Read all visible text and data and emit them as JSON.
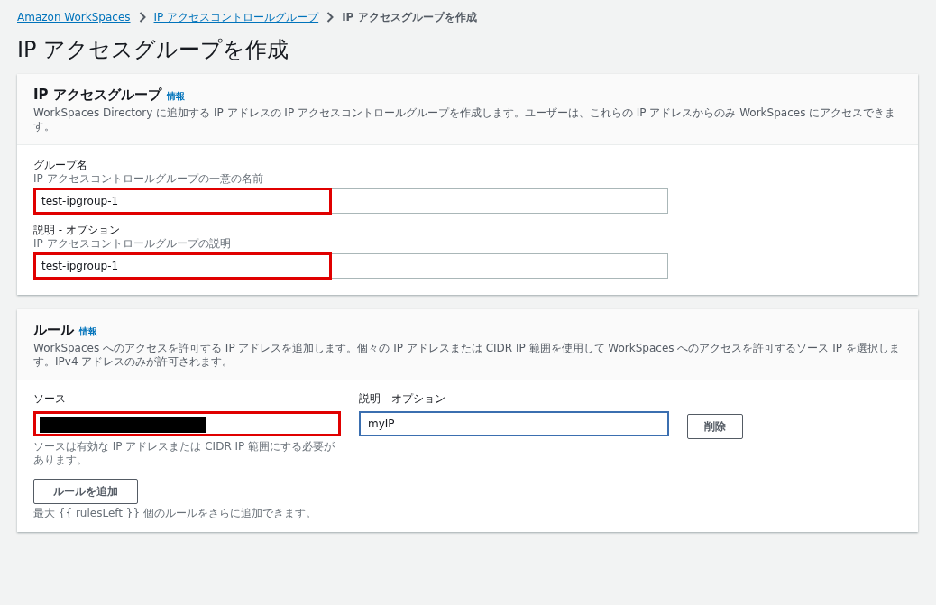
{
  "breadcrumbs": [
    {
      "label": "Amazon WorkSpaces",
      "link": true
    },
    {
      "label": "IP アクセスコントロールグループ",
      "link": true
    },
    {
      "label": "IP アクセスグループを作成",
      "link": false
    }
  ],
  "page_title": "IP アクセスグループを作成",
  "group_panel": {
    "title": "IP アクセスグループ",
    "info": "情報",
    "description": "WorkSpaces Directory に追加する IP アドレスの IP アクセスコントロールグループを作成します。ユーザーは、これらの IP アドレスからのみ WorkSpaces にアクセスできます。",
    "fields": [
      {
        "label": "グループ名",
        "hint": "IP アクセスコントロールグループの一意の名前",
        "value": "test-ipgroup-1",
        "highlighted": true
      },
      {
        "label": "説明 - オプション",
        "hint": "IP アクセスコントロールグループの説明",
        "value": "test-ipgroup-1",
        "highlighted": true
      }
    ]
  },
  "rules_panel": {
    "title": "ルール",
    "info": "情報",
    "description": "WorkSpaces へのアクセスを許可する IP アドレスを追加します。個々の IP アドレスまたは CIDR IP 範囲を使用して WorkSpaces へのアクセスを許可するソース IP を選択します。IPv4 アドレスのみが許可されます。",
    "rule": {
      "source_label": "ソース",
      "source_redacted": true,
      "source_highlighted": true,
      "source_hint": "ソースは有効な IP アドレスまたは CIDR IP 範囲にする必要があります。",
      "description_label": "説明 - オプション",
      "description_value": "myIP",
      "description_focused": true,
      "remove_button": "削除"
    },
    "add_button": "ルールを追加",
    "limit_text": "最大 {{ rulesLeft }} 個のルールをさらに追加できます。"
  }
}
